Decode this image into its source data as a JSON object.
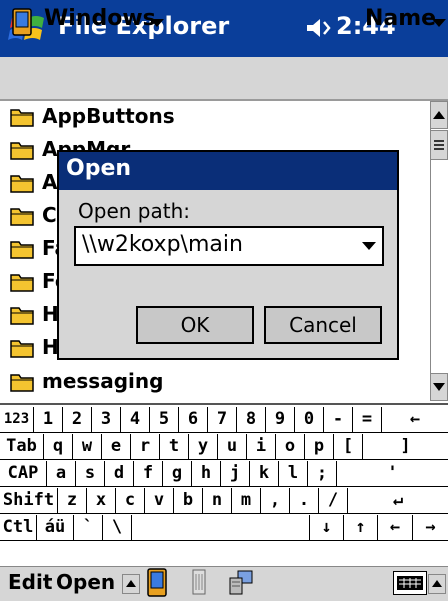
{
  "titlebar": {
    "title": "File Explorer",
    "time": "2:44",
    "start_icon": "windows-flag-icon",
    "volume_icon": "speaker-icon"
  },
  "navbar": {
    "folder": "Windows",
    "sort": "Name"
  },
  "files": [
    "AppButtons",
    "AppMgr",
    "A",
    "C",
    "Fa",
    "Fo",
    "H",
    "Hi",
    "messaging"
  ],
  "dialog": {
    "title": "Open",
    "path_label": "Open path:",
    "path_value": "\\\\w2koxp\\main",
    "ok_label": "OK",
    "cancel_label": "Cancel"
  },
  "keyboard": {
    "rows": [
      [
        "123",
        "1",
        "2",
        "3",
        "4",
        "5",
        "6",
        "7",
        "8",
        "9",
        "0",
        "-",
        "=",
        "←"
      ],
      [
        "Tab",
        "q",
        "w",
        "e",
        "r",
        "t",
        "y",
        "u",
        "i",
        "o",
        "p",
        "[",
        "]"
      ],
      [
        "CAP",
        "a",
        "s",
        "d",
        "f",
        "g",
        "h",
        "j",
        "k",
        "l",
        ";",
        "'"
      ],
      [
        "Shift",
        "z",
        "x",
        "c",
        "v",
        "b",
        "n",
        "m",
        ",",
        ".",
        "/",
        "↵"
      ],
      [
        "Ctl",
        "áü",
        "`",
        "\\",
        "",
        "↓",
        "↑",
        "←",
        "→"
      ]
    ]
  },
  "cmdbar": {
    "edit_label": "Edit",
    "open_label": "Open"
  },
  "colors": {
    "titlebar": "#0a3e9a",
    "dialog_title": "#0a2e78",
    "chrome": "#d6d6d6",
    "folder": "#f4c430"
  }
}
